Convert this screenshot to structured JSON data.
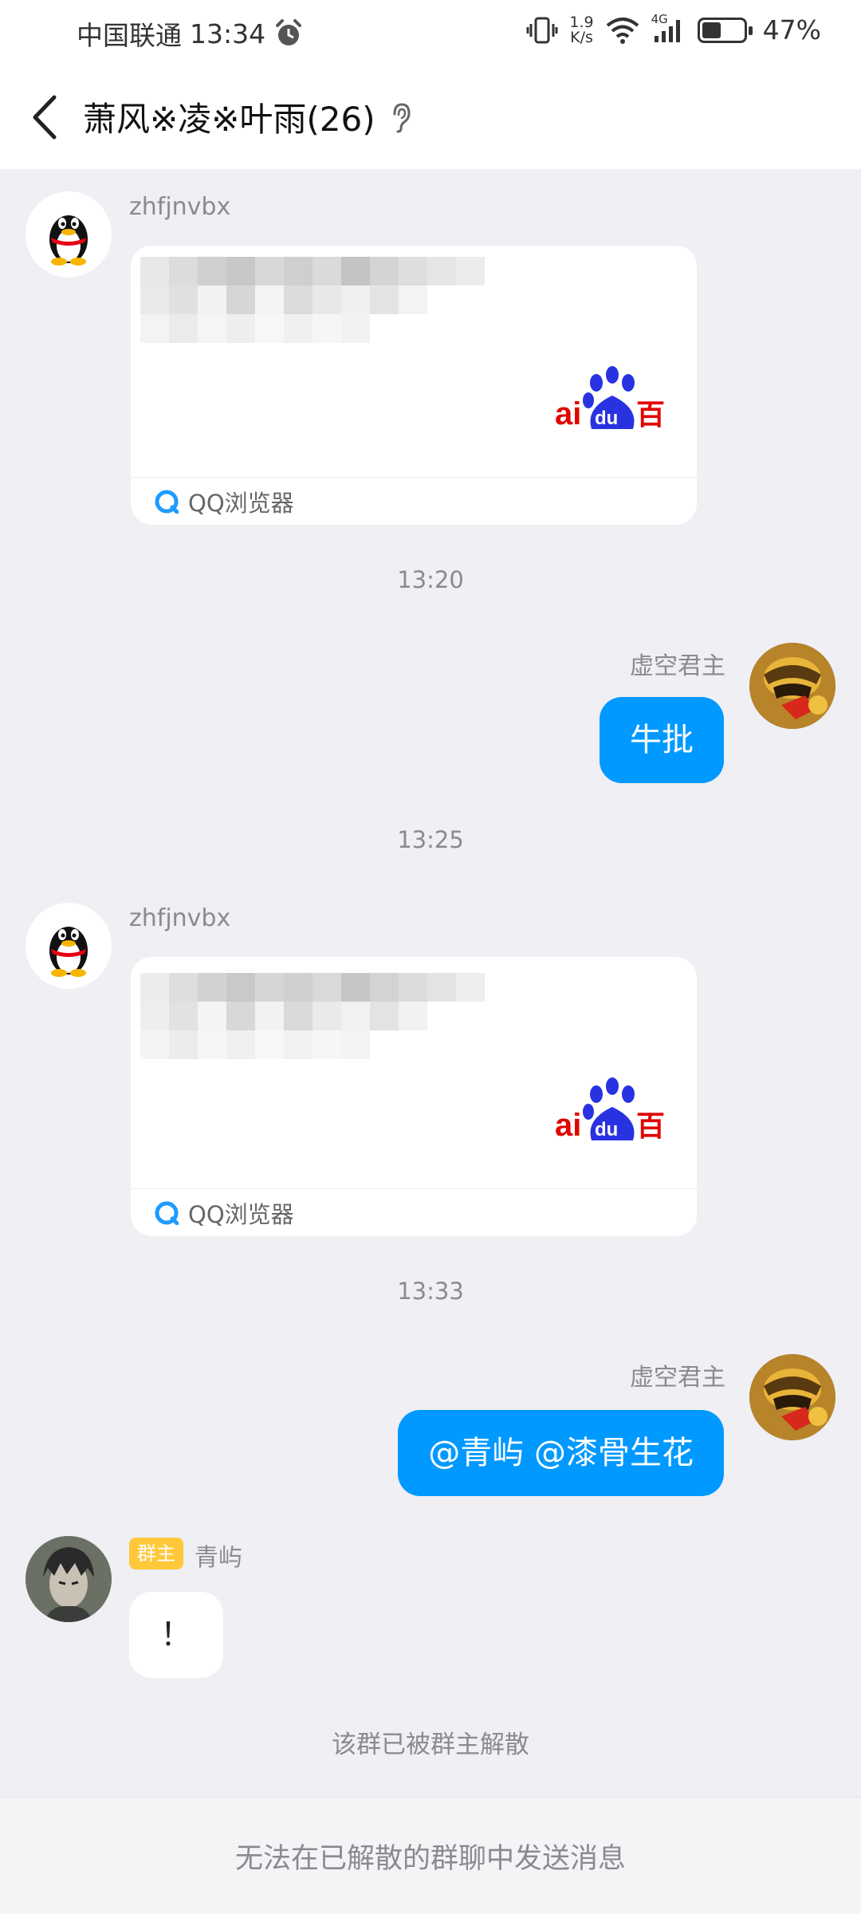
{
  "status": {
    "carrier": "中国联通",
    "time": "13:34",
    "net_speed_value": "1.9",
    "net_speed_unit": "K/s",
    "net_type": "4G",
    "battery": "47%",
    "battery_level": 0.47
  },
  "header": {
    "title": "萧风※凌※叶雨(26)"
  },
  "messages": [
    {
      "sender": "zhfjnvbx",
      "card_source": "QQ浏览器"
    },
    {
      "time": "13:20"
    },
    {
      "sender": "虚空君主",
      "text": "牛批"
    },
    {
      "time": "13:25"
    },
    {
      "sender": "zhfjnvbx",
      "card_source": "QQ浏览器"
    },
    {
      "time": "13:33"
    },
    {
      "sender": "虚空君主",
      "text": "@青屿 @漆骨生花"
    },
    {
      "sender": "青屿",
      "role": "群主",
      "text": "！"
    }
  ],
  "system_notice": "该群已被群主解散",
  "footer_notice": "无法在已解散的群聊中发送消息",
  "colors": {
    "accent": "#0099ff",
    "badge": "#ffc73a",
    "background": "#efeff4"
  }
}
